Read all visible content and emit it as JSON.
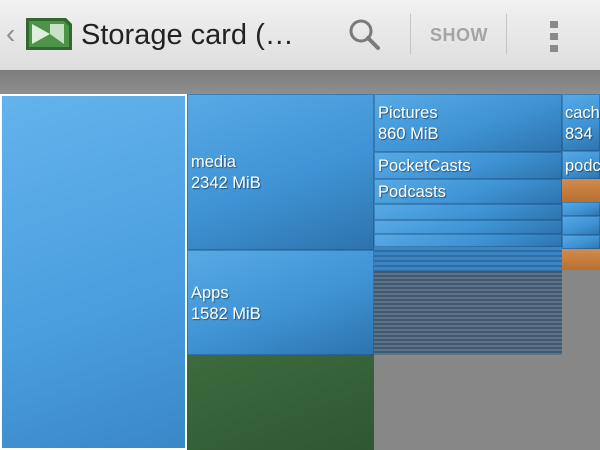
{
  "actionbar": {
    "up_icon": "chevron-left-icon",
    "app_icon": "storage-card-icon",
    "title": "Storage card (…",
    "search_icon": "search-icon",
    "show_label": "SHOW",
    "overflow_icon": "overflow-menu-icon"
  },
  "treemap": {
    "media": {
      "name": "media",
      "size": "2342 MiB"
    },
    "apps": {
      "name": "Apps",
      "size": "1582 MiB"
    },
    "pictures": {
      "name": "Pictures",
      "size": "860 MiB"
    },
    "cache": {
      "name": "cach",
      "size": "834"
    },
    "pocketcasts": {
      "name": "PocketCasts"
    },
    "podcasts": {
      "name": "Podcasts"
    },
    "podc": {
      "name": "podc"
    }
  },
  "colors": {
    "tile_blue": "#4a9ede",
    "tile_green": "#2f5831",
    "tile_orange": "#c57b3e",
    "background_gray": "#878787"
  }
}
